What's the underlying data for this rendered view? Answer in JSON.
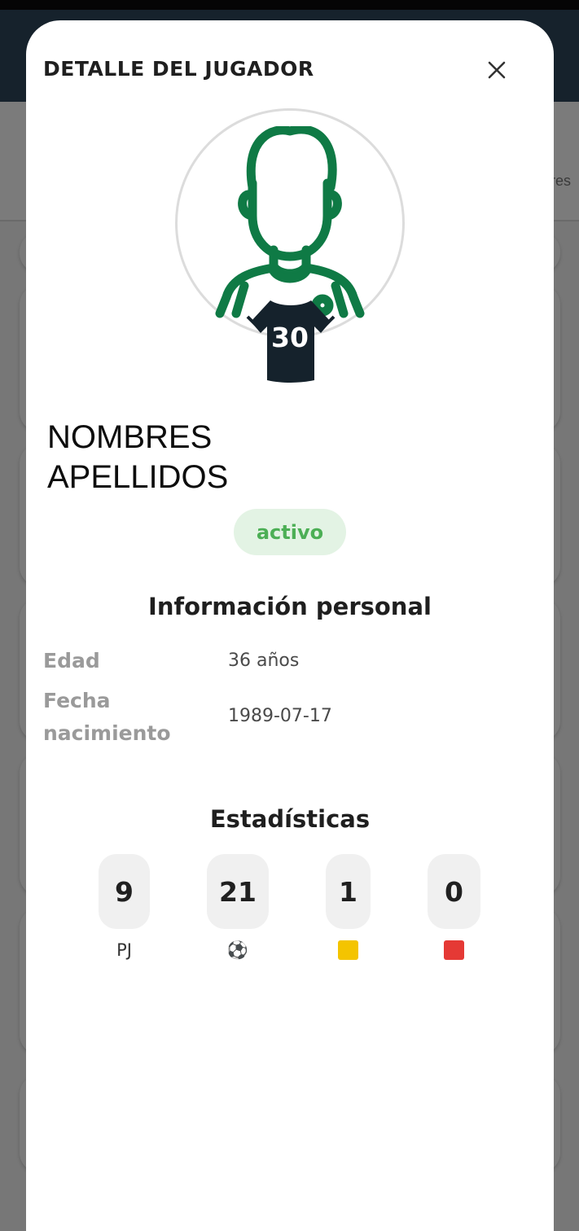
{
  "modal": {
    "title": "DETALLE DEL JUGADOR",
    "close_icon": "close-icon"
  },
  "player": {
    "number": "30",
    "first_name": "NOMBRES",
    "last_name": "APELLIDOS",
    "status": "activo",
    "avatar_icon": "player-avatar-icon",
    "jersey_icon": "jersey-icon"
  },
  "personal_info": {
    "title": "Información personal",
    "age_label": "Edad",
    "age_value": "36 años",
    "birth_label_line1": "Fecha",
    "birth_label_line2": "nacimiento",
    "birth_value": "1989-07-17"
  },
  "stats": {
    "title": "Estadísticas",
    "items": [
      {
        "value": "9",
        "label": "PJ"
      },
      {
        "value": "21",
        "label": "⚽"
      },
      {
        "value": "1",
        "label": "yellow-card-icon"
      },
      {
        "value": "0",
        "label": "red-card-icon"
      }
    ]
  },
  "background": {
    "tab_text": "res"
  },
  "colors": {
    "accent_green": "#0f7a45",
    "status_green": "#4caf55",
    "status_bg": "#e3f3e4",
    "jersey": "#15222c",
    "yellow_card": "#f4c400",
    "red_card": "#e53935"
  }
}
